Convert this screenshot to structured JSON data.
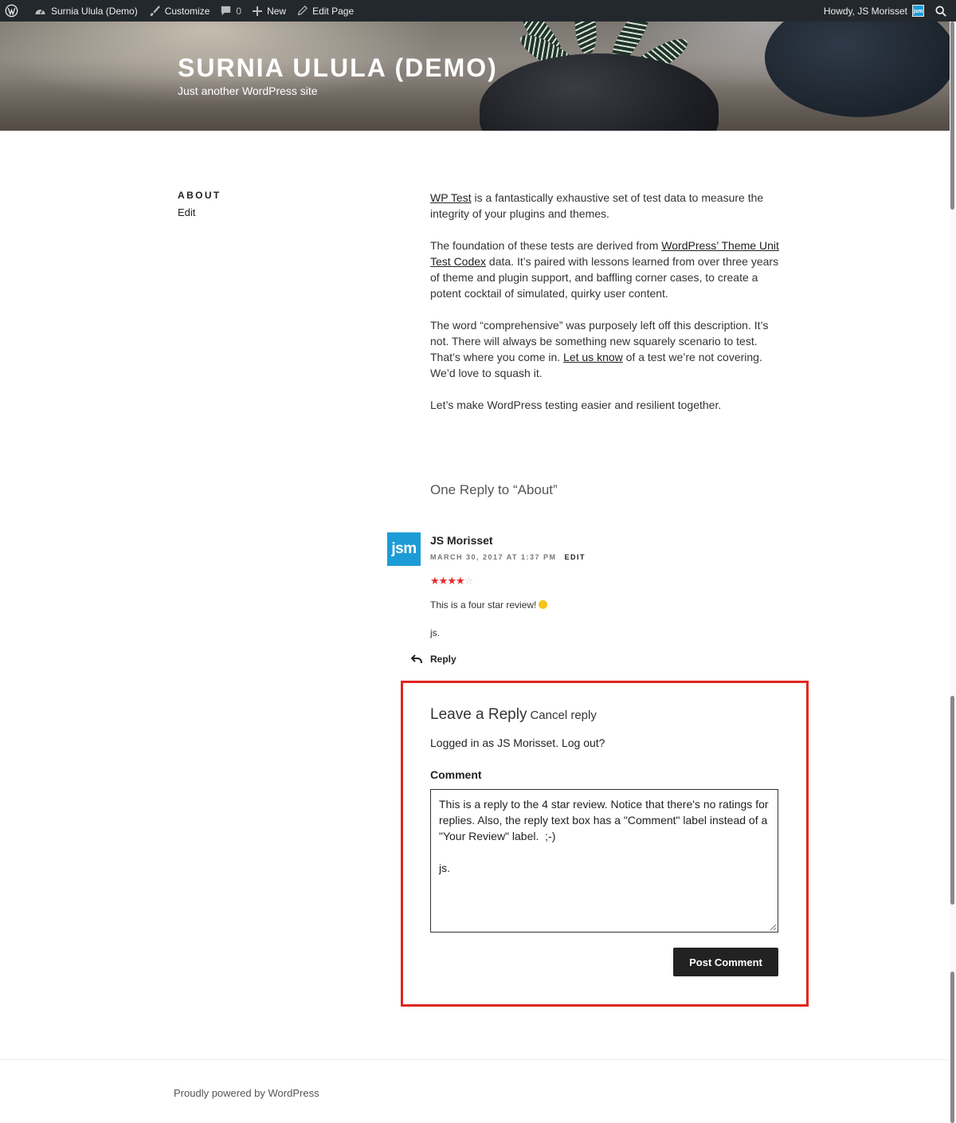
{
  "admin_bar": {
    "site_name": "Surnia Ulula (Demo)",
    "customize": "Customize",
    "comments_count": "0",
    "new": "New",
    "edit_page": "Edit Page",
    "howdy": "Howdy, JS Morisset",
    "avatar_text": "jsm"
  },
  "header": {
    "site_title": "SURNIA ULULA (DEMO)",
    "tagline": "Just another WordPress site"
  },
  "page": {
    "title": "About",
    "edit_link": "Edit",
    "content": {
      "p1_link": "WP Test",
      "p1_rest": " is a fantastically exhaustive set of test data to measure the integrity of your plugins and themes.",
      "p2_start": "The foundation of these tests are derived from ",
      "p2_link": "WordPress’ Theme Unit Test Codex",
      "p2_rest": " data. It’s paired with lessons learned from over three years of theme and plugin support, and baffling corner cases, to create a potent cocktail of simulated, quirky user content.",
      "p3_start": "The word “comprehensive” was purposely left off this description. It’s not. There will always be something new squarely scenario to test. That’s where you come in. ",
      "p3_link": "Let us know",
      "p3_rest": " of a test we’re not covering. We’d love to squash it.",
      "p4": "Let’s make WordPress testing easier and resilient together."
    }
  },
  "comments": {
    "title": "One Reply to “About”",
    "items": [
      {
        "avatar_text": "jsm",
        "author": "JS Morisset",
        "date": "MARCH 30, 2017 AT 1:37 PM",
        "edit": "EDIT",
        "rating": 4,
        "rating_max": 5,
        "text": "This is a four star review!",
        "signature": "js.",
        "reply": "Reply"
      }
    ]
  },
  "reply_form": {
    "title": "Leave a Reply",
    "cancel": "Cancel reply",
    "logged_in": "Logged in as JS Morisset. Log out?",
    "comment_label": "Comment",
    "comment_value": "This is a reply to the 4 star review. Notice that there's no ratings for replies. Also, the reply text box has a \"Comment\" label instead of a \"Your Review\" label.  ;-)\n\njs.",
    "submit": "Post Comment"
  },
  "footer": {
    "text": "Proudly powered by WordPress"
  },
  "colors": {
    "admin_bar_bg": "#23282d",
    "highlight_border": "#e0261f",
    "avatar_bg": "#1c9cd6",
    "star_color": "#e02b27",
    "button_bg": "#222222"
  },
  "icons": [
    "wordpress-icon",
    "dashboard-icon",
    "paintbrush-icon",
    "comment-bubble-icon",
    "plus-icon",
    "pencil-icon",
    "search-icon",
    "reply-arrow-icon",
    "smiley-icon",
    "star-icon"
  ]
}
